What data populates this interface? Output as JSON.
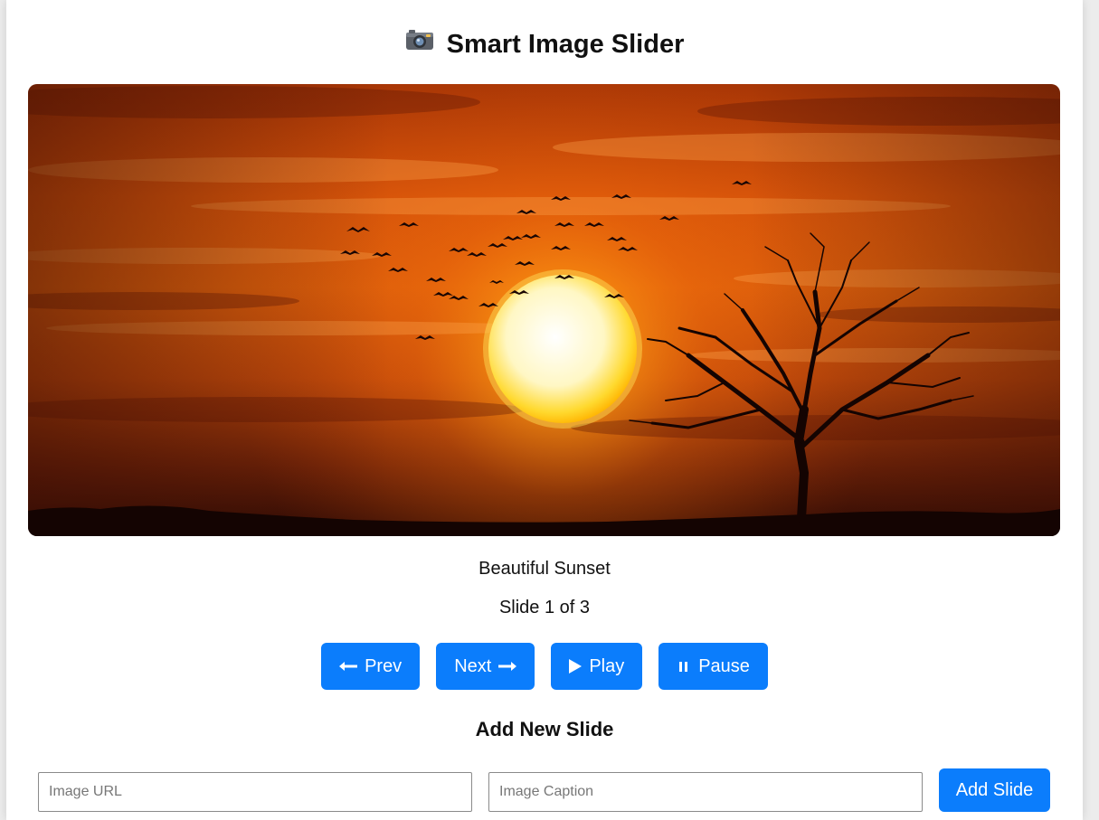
{
  "app": {
    "title": "Smart Image Slider",
    "title_icon": "camera-icon"
  },
  "slider": {
    "image_icon": "sunset-image",
    "caption": "Beautiful Sunset",
    "counter": "Slide 1 of 3",
    "current_slide": 1,
    "total_slides": 3
  },
  "controls": {
    "prev_label": "Prev",
    "prev_icon": "arrow-left-icon",
    "next_label": "Next",
    "next_icon": "arrow-right-icon",
    "play_label": "Play",
    "play_icon": "play-icon",
    "pause_label": "Pause",
    "pause_icon": "pause-icon"
  },
  "add_slide": {
    "heading": "Add New Slide",
    "url_placeholder": "Image URL",
    "url_value": "",
    "caption_placeholder": "Image Caption",
    "caption_value": "",
    "button_label": "Add Slide"
  },
  "colors": {
    "accent": "#0b7dfc",
    "page_background": "#ffffff",
    "outer_background": "#ececec"
  }
}
